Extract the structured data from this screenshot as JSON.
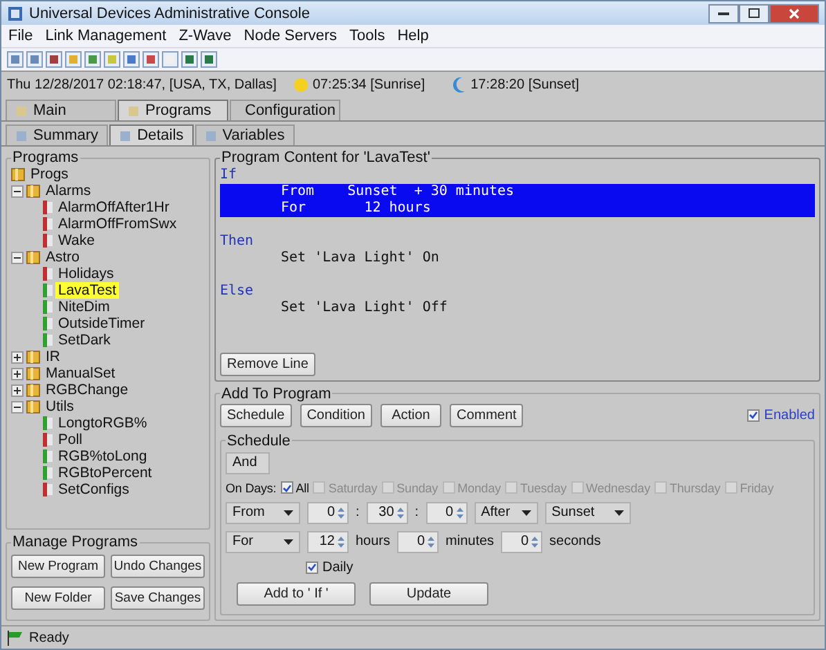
{
  "window": {
    "title": "Universal Devices Administrative Console"
  },
  "menu": [
    "File",
    "Link Management",
    "Z-Wave",
    "Node Servers",
    "Tools",
    "Help"
  ],
  "info_bar": {
    "datetime": "Thu 12/28/2017 02:18:47,  [USA, TX, Dallas]",
    "sunrise": "07:25:34 [Sunrise]",
    "sunset": "17:28:20 [Sunset]"
  },
  "main_tabs": [
    {
      "label": "Main",
      "selected": false
    },
    {
      "label": "Programs",
      "selected": true
    },
    {
      "label": "Configuration",
      "selected": false
    }
  ],
  "sub_tabs": [
    {
      "label": "Summary",
      "selected": false
    },
    {
      "label": "Details",
      "selected": true
    },
    {
      "label": "Variables",
      "selected": false
    }
  ],
  "programs_panel": {
    "title": "Programs",
    "tree": [
      {
        "label": "Progs",
        "kind": "folder",
        "selected": false,
        "children": [
          {
            "label": "Alarms",
            "kind": "folder",
            "expanded": true,
            "selected": false,
            "children": [
              {
                "label": "AlarmOffAfter1Hr",
                "kind": "program",
                "color": "#c03030",
                "selected": false
              },
              {
                "label": "AlarmOffFromSwx",
                "kind": "program",
                "color": "#c03030",
                "selected": false
              },
              {
                "label": "Wake",
                "kind": "program",
                "color": "#c03030",
                "selected": false
              }
            ]
          },
          {
            "label": "Astro",
            "kind": "folder",
            "expanded": true,
            "selected": false,
            "children": [
              {
                "label": "Holidays",
                "kind": "program",
                "color": "#c03030",
                "selected": false
              },
              {
                "label": "LavaTest",
                "kind": "program",
                "color": "#30a030",
                "selected": true
              },
              {
                "label": "NiteDim",
                "kind": "program",
                "color": "#30a030",
                "selected": false
              },
              {
                "label": "OutsideTimer",
                "kind": "program",
                "color": "#30a030",
                "selected": false
              },
              {
                "label": "SetDark",
                "kind": "program",
                "color": "#30a030",
                "selected": false
              }
            ]
          },
          {
            "label": "IR",
            "kind": "folder",
            "expanded": false,
            "selected": false
          },
          {
            "label": "ManualSet",
            "kind": "folder",
            "expanded": false,
            "selected": false
          },
          {
            "label": "RGBChange",
            "kind": "folder",
            "expanded": false,
            "selected": false
          },
          {
            "label": "Utils",
            "kind": "folder",
            "expanded": true,
            "selected": false,
            "children": [
              {
                "label": "LongtoRGB%",
                "kind": "program",
                "color": "#30a030",
                "selected": false
              },
              {
                "label": "Poll",
                "kind": "program",
                "color": "#c03030",
                "selected": false
              },
              {
                "label": "RGB%toLong",
                "kind": "program",
                "color": "#30a030",
                "selected": false
              },
              {
                "label": "RGBtoPercent",
                "kind": "program",
                "color": "#30a030",
                "selected": false
              },
              {
                "label": "SetConfigs",
                "kind": "program",
                "color": "#c03030",
                "selected": false
              }
            ]
          }
        ]
      }
    ]
  },
  "manage_programs": {
    "title": "Manage Programs",
    "buttons": [
      "New Program",
      "Undo Changes",
      "New Folder",
      "Save Changes"
    ]
  },
  "program_content": {
    "title": "Program Content for 'LavaTest'",
    "lines": [
      {
        "kind": "keyword",
        "text": "If",
        "selected": false
      },
      {
        "kind": "statement",
        "text": "From    Sunset  + 30 minutes",
        "selected": true
      },
      {
        "kind": "statement",
        "text": "For       12 hours",
        "selected": true
      },
      {
        "kind": "keyword",
        "text": "Then",
        "selected": false
      },
      {
        "kind": "statement",
        "text": "Set 'Lava Light' On",
        "selected": false
      },
      {
        "kind": "keyword",
        "text": "Else",
        "selected": false
      },
      {
        "kind": "statement",
        "text": "Set 'Lava Light' Off",
        "selected": false
      }
    ],
    "remove_button": "Remove Line"
  },
  "add_to_program": {
    "title": "Add To Program",
    "buttons": [
      "Schedule",
      "Condition",
      "Action",
      "Comment"
    ],
    "enabled": {
      "label": "Enabled",
      "checked": true
    },
    "schedule": {
      "title": "Schedule",
      "conjunction": "And",
      "days_label": "On Days:",
      "days": [
        {
          "label": "All",
          "checked": true,
          "disabled": false
        },
        {
          "label": "Saturday",
          "checked": false,
          "disabled": true
        },
        {
          "label": "Sunday",
          "checked": false,
          "disabled": true
        },
        {
          "label": "Monday",
          "checked": false,
          "disabled": true
        },
        {
          "label": "Tuesday",
          "checked": false,
          "disabled": true
        },
        {
          "label": "Wednesday",
          "checked": false,
          "disabled": true
        },
        {
          "label": "Thursday",
          "checked": false,
          "disabled": true
        },
        {
          "label": "Friday",
          "checked": false,
          "disabled": true
        }
      ],
      "from_row": {
        "mode": "From",
        "hours": "0",
        "separator_1": ":",
        "minutes": "30",
        "separator_2": ":",
        "seconds": "0",
        "relation": "After",
        "event": "Sunset"
      },
      "for_row": {
        "mode": "For",
        "hours": "12",
        "hours_label": "hours",
        "minutes": "0",
        "minutes_label": "minutes",
        "seconds": "0",
        "seconds_label": "seconds"
      },
      "daily": {
        "label": "Daily",
        "checked": true
      },
      "buttons": [
        "Add to ' If '",
        "Update"
      ]
    }
  },
  "status_bar": {
    "text": "Ready"
  }
}
